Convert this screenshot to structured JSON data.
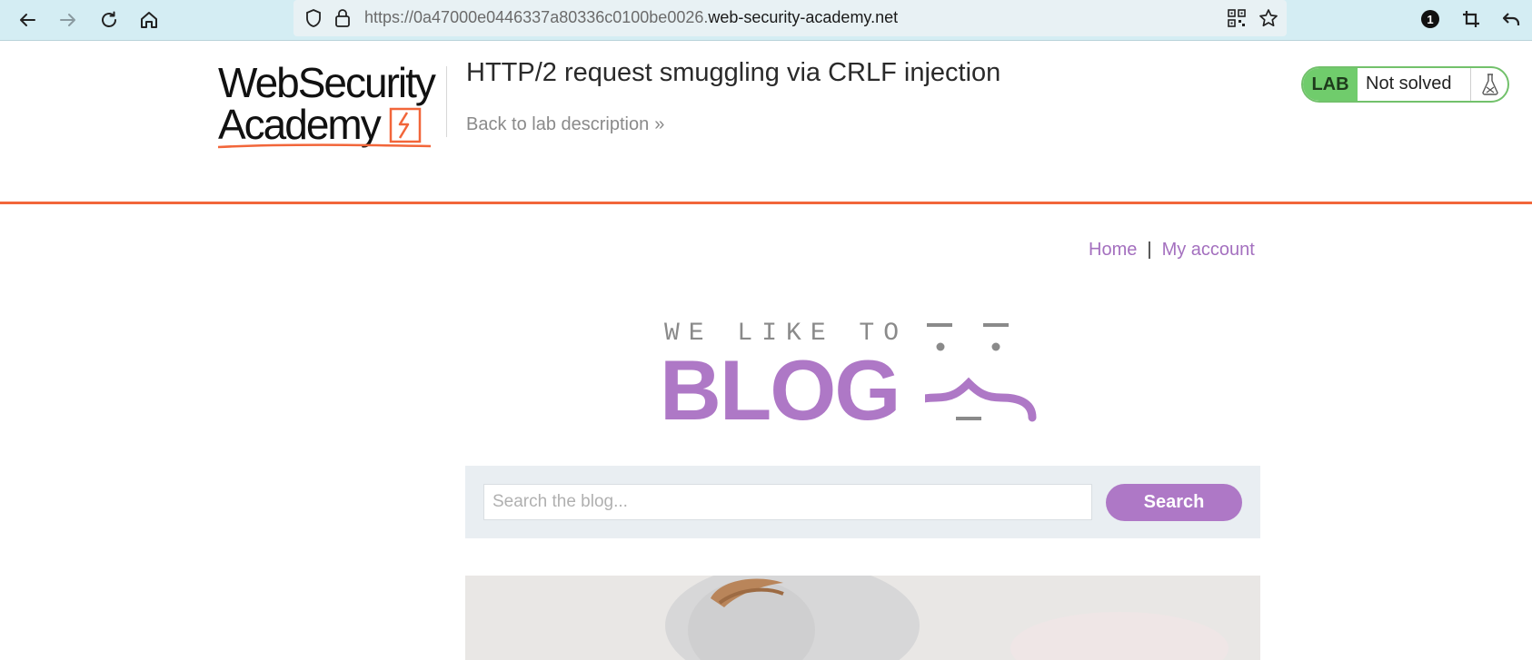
{
  "browser": {
    "url_prefix": "https://0a47000e0446337a80336c0100be0026.",
    "url_domain": "web-security-academy.net",
    "notification_count": "1",
    "icons": [
      "back-arrow-icon",
      "forward-arrow-icon",
      "reload-icon",
      "home-icon",
      "shield-icon",
      "lock-icon",
      "qr-code-icon",
      "bookmark-star-icon",
      "crop-icon",
      "undo-arrow-icon"
    ]
  },
  "academy": {
    "logo_line1": "WebSecurity",
    "logo_line2": "Academy",
    "lab_title": "HTTP/2 request smuggling via CRLF injection",
    "back_link": "Back to lab description",
    "back_chevron": "»",
    "status_tag": "LAB",
    "status_text": "Not solved",
    "accent_color": "#f2663a",
    "status_color": "#70cc6c"
  },
  "blog": {
    "nav_home": "Home",
    "nav_separator": "|",
    "nav_account": "My account",
    "tagline": "WE LIKE TO",
    "title": "BLOG",
    "brand_color": "#ae78c6",
    "search_placeholder": "Search the blog...",
    "search_button": "Search"
  }
}
